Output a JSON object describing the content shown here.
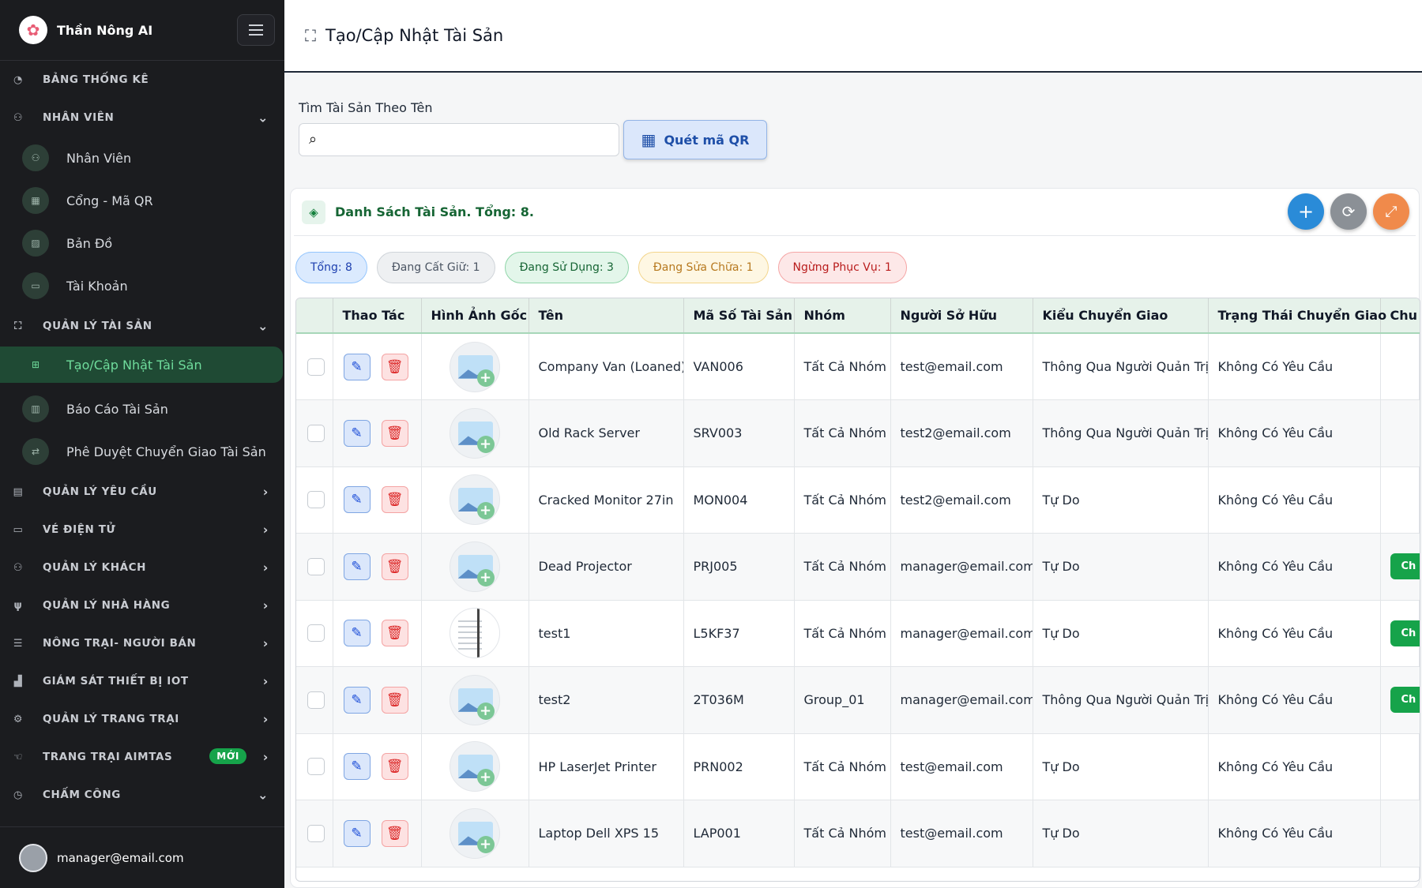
{
  "app": {
    "title": "Thần Nông AI"
  },
  "sidebar": {
    "sections": [
      {
        "label": "BẢNG THỐNG KÊ",
        "icon": "gauge-icon"
      },
      {
        "label": "NHÂN VIÊN",
        "icon": "users-icon",
        "expanded": true,
        "items": [
          {
            "label": "Nhân Viên",
            "icon": "people-icon"
          },
          {
            "label": "Cổng - Mã QR",
            "icon": "qr-icon"
          },
          {
            "label": "Bản Đồ",
            "icon": "map-icon"
          },
          {
            "label": "Tài Khoản",
            "icon": "id-card-icon"
          }
        ]
      },
      {
        "label": "QUẢN LÝ TÀI SẢN",
        "icon": "asset-icon",
        "expanded": true,
        "items": [
          {
            "label": "Tạo/Cập Nhật Tài Sản",
            "icon": "plus-square-icon",
            "active": true
          },
          {
            "label": "Báo Cáo Tài Sản",
            "icon": "report-icon"
          },
          {
            "label": "Phê Duyệt Chuyển Giao Tài Sản",
            "icon": "transfer-icon"
          }
        ]
      },
      {
        "label": "QUẢN LÝ YÊU CẦU",
        "icon": "clipboard-icon"
      },
      {
        "label": "VÉ ĐIỆN TỬ",
        "icon": "ticket-icon"
      },
      {
        "label": "QUẢN LÝ KHÁCH",
        "icon": "guests-icon"
      },
      {
        "label": "QUẢN LÝ NHÀ HÀNG",
        "icon": "restaurant-icon"
      },
      {
        "label": "NÔNG TRẠI- NGƯỜI BÁN",
        "icon": "store-icon"
      },
      {
        "label": "GIÁM SÁT THIẾT BỊ IOT",
        "icon": "factory-icon"
      },
      {
        "label": "QUẢN LÝ TRANG TRẠI",
        "icon": "tractor-icon"
      },
      {
        "label": "TRANG TRẠI AIMTAS",
        "icon": "hand-icon",
        "badge": "MỚI"
      },
      {
        "label": "CHẤM CÔNG",
        "icon": "clock-icon"
      }
    ],
    "user_email": "manager@email.com"
  },
  "header": {
    "title": "Tạo/Cập Nhật Tài Sản"
  },
  "search": {
    "label": "Tìm Tài Sản Theo Tên",
    "value": "",
    "placeholder": ""
  },
  "qr_button": {
    "label": "Quét mã QR"
  },
  "list": {
    "title": "Danh Sách Tài Sản. Tổng: 8."
  },
  "filters": [
    {
      "label": "Tổng: 8"
    },
    {
      "label": "Đang Cất Giữ: 1"
    },
    {
      "label": "Đang Sử Dụng: 3"
    },
    {
      "label": "Đang Sửa Chữa: 1"
    },
    {
      "label": "Ngừng Phục Vụ: 1"
    }
  ],
  "table": {
    "headers": [
      "",
      "Thao Tác",
      "Hình Ảnh Gốc",
      "Tên",
      "Mã Số Tài Sản",
      "Nhóm",
      "Người Sở Hữu",
      "Kiểu Chuyển Giao",
      "Trạng Thái Chuyển Giao",
      "Chu"
    ],
    "rows": [
      {
        "name": "Company Van (Loaned)",
        "code": "VAN006",
        "group": "Tất Cả Nhóm",
        "owner": "test@email.com",
        "transfer_type": "Thông Qua Người Quản Trị",
        "transfer_status": "Không Có Yêu Cầu",
        "image": "placeholder",
        "chip": ""
      },
      {
        "name": "Old Rack Server",
        "code": "SRV003",
        "group": "Tất Cả Nhóm",
        "owner": "test2@email.com",
        "transfer_type": "Thông Qua Người Quản Trị",
        "transfer_status": "Không Có Yêu Cầu",
        "image": "placeholder",
        "chip": ""
      },
      {
        "name": "Cracked Monitor 27in",
        "code": "MON004",
        "group": "Tất Cả Nhóm",
        "owner": "test2@email.com",
        "transfer_type": "Tự Do",
        "transfer_status": "Không Có Yêu Cầu",
        "image": "placeholder",
        "chip": ""
      },
      {
        "name": "Dead Projector",
        "code": "PRJ005",
        "group": "Tất Cả Nhóm",
        "owner": "manager@email.com",
        "transfer_type": "Tự Do",
        "transfer_status": "Không Có Yêu Cầu",
        "image": "placeholder",
        "chip": "Ch"
      },
      {
        "name": "test1",
        "code": "L5KF37",
        "group": "Tất Cả Nhóm",
        "owner": "manager@email.com",
        "transfer_type": "Tự Do",
        "transfer_status": "Không Có Yêu Cầu",
        "image": "document",
        "chip": "Ch"
      },
      {
        "name": "test2",
        "code": "2T036M",
        "group": "Group_01",
        "owner": "manager@email.com",
        "transfer_type": "Thông Qua Người Quản Trị",
        "transfer_status": "Không Có Yêu Cầu",
        "image": "placeholder",
        "chip": "Ch"
      },
      {
        "name": "HP LaserJet Printer",
        "code": "PRN002",
        "group": "Tất Cả Nhóm",
        "owner": "test@email.com",
        "transfer_type": "Tự Do",
        "transfer_status": "Không Có Yêu Cầu",
        "image": "placeholder",
        "chip": ""
      },
      {
        "name": "Laptop Dell XPS 15",
        "code": "LAP001",
        "group": "Tất Cả Nhóm",
        "owner": "test@email.com",
        "transfer_type": "Tự Do",
        "transfer_status": "Không Có Yêu Cầu",
        "image": "placeholder",
        "chip": ""
      }
    ]
  },
  "colors": {
    "sidebar_bg": "#1b1c1f",
    "active_green": "#6fdc9c",
    "primary_blue": "#2a8bd8",
    "success_green": "#16a34a",
    "danger_red": "#dc2626"
  }
}
